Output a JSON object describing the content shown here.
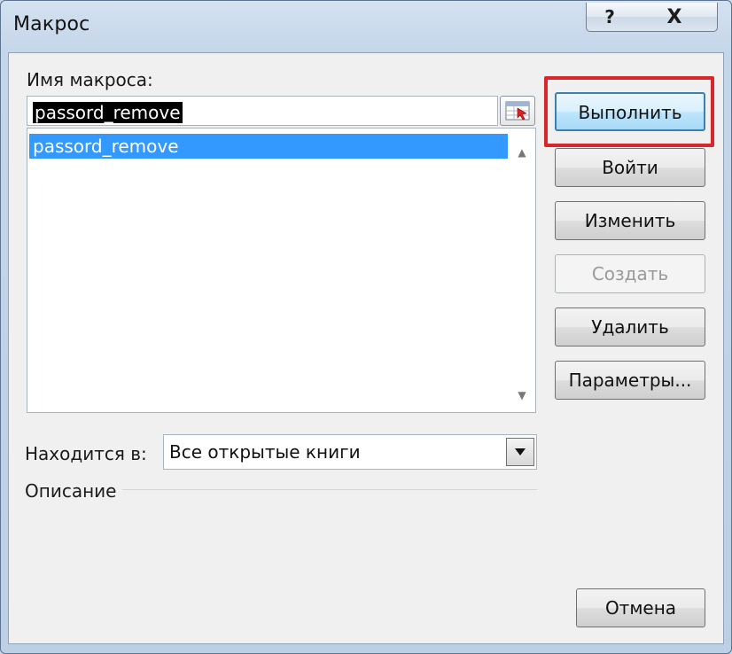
{
  "window": {
    "title": "Макрос",
    "help_label": "?",
    "close_label": "X"
  },
  "macro_name": {
    "label": "Имя макроса:",
    "value": "passord_remove"
  },
  "macro_list": {
    "items": [
      "passord_remove"
    ],
    "selected_index": 0
  },
  "buttons": {
    "run": "Выполнить",
    "step_into": "Войти",
    "edit": "Изменить",
    "create": "Создать",
    "delete": "Удалить",
    "options": "Параметры...",
    "cancel": "Отмена"
  },
  "location": {
    "label": "Находится в:",
    "value": "Все открытые книги"
  },
  "description": {
    "label": "Описание"
  },
  "colors": {
    "selection": "#3399ff",
    "highlight_border": "#d9262c",
    "primary_border": "#3c7fb1"
  }
}
